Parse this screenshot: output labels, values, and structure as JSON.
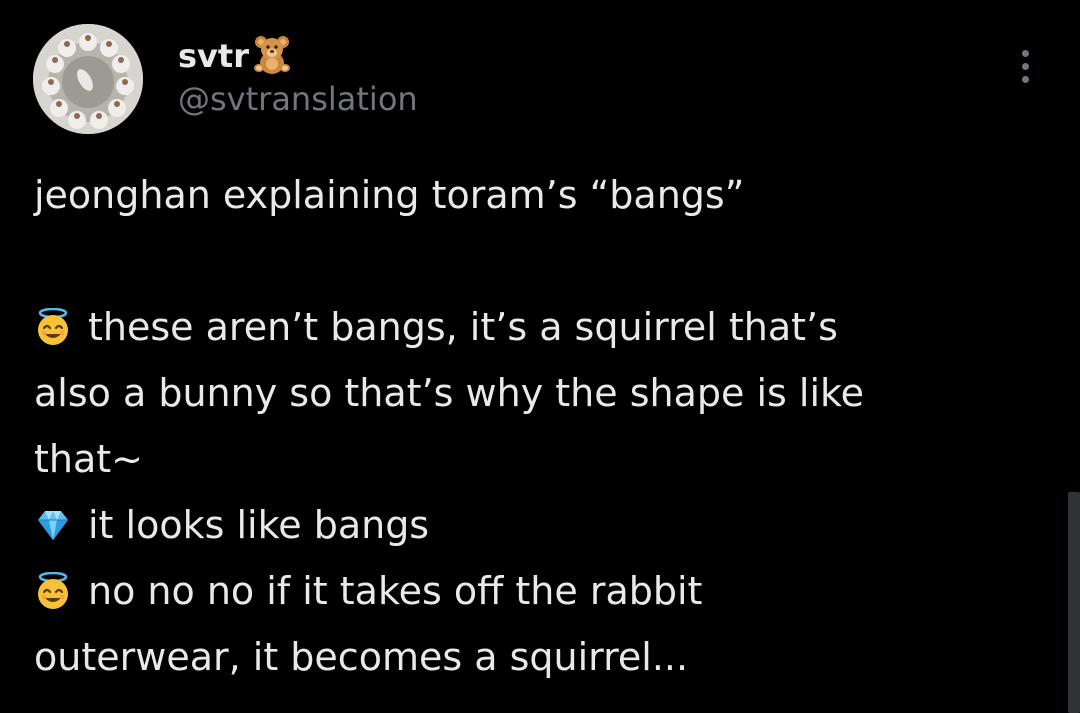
{
  "tweet": {
    "author": {
      "display_name": "svtr",
      "name_emoji": "teddy-bear-emoji",
      "handle": "@svtranslation",
      "avatar": "avatar-photo"
    },
    "more_menu_icon": "more-vertical-icon",
    "lines": [
      {
        "icon": null,
        "text": "jeonghan explaining toram’s “bangs”"
      },
      {
        "icon": null,
        "text": ""
      },
      {
        "icon": "smiling-face-with-halo-emoji",
        "text": "these aren’t bangs, it’s a squirrel that’s"
      },
      {
        "icon": null,
        "text": "also a bunny so that’s why the shape is like"
      },
      {
        "icon": null,
        "text": "that~"
      },
      {
        "icon": "gem-stone-emoji",
        "text": "it looks like bangs"
      },
      {
        "icon": "smiling-face-with-halo-emoji",
        "text": "no no no if it takes off the rabbit"
      },
      {
        "icon": null,
        "text": "outerwear, it becomes a squirrel..."
      }
    ]
  },
  "colors": {
    "background": "#000000",
    "primary_text": "#e7e9ea",
    "secondary_text": "#71767b"
  }
}
